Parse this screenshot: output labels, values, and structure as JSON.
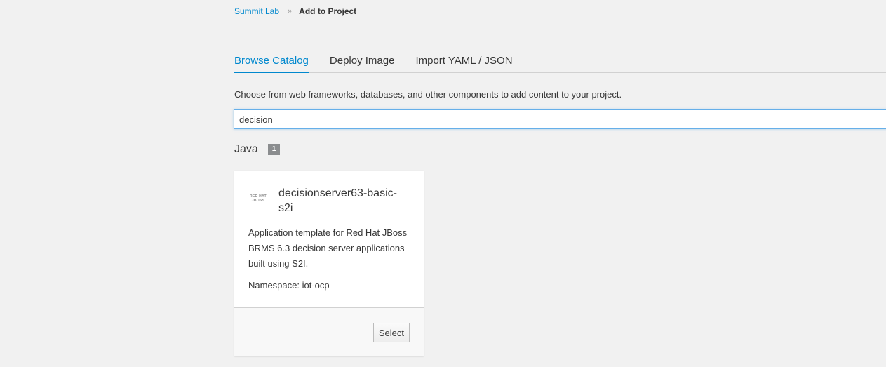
{
  "breadcrumb": {
    "parent": "Summit Lab",
    "separator": "»",
    "current": "Add to Project"
  },
  "tabs": [
    {
      "label": "Browse Catalog",
      "active": true
    },
    {
      "label": "Deploy Image",
      "active": false
    },
    {
      "label": "Import YAML / JSON",
      "active": false
    }
  ],
  "intro_text": "Choose from web frameworks, databases, and other components to add content to your project.",
  "search": {
    "value": "decision"
  },
  "category": {
    "name": "Java",
    "count": "1"
  },
  "card": {
    "logo_text": "RED HAT JBOSS",
    "title": "decisionserver63-basic-s2i",
    "description": "Application template for Red Hat JBoss BRMS 6.3 decision server applications built using S2I.",
    "namespace": "Namespace: iot-ocp",
    "select_label": "Select"
  },
  "colors": {
    "link": "#0088ce",
    "background": "#f1f1f1",
    "focus_border": "#66afe9"
  }
}
